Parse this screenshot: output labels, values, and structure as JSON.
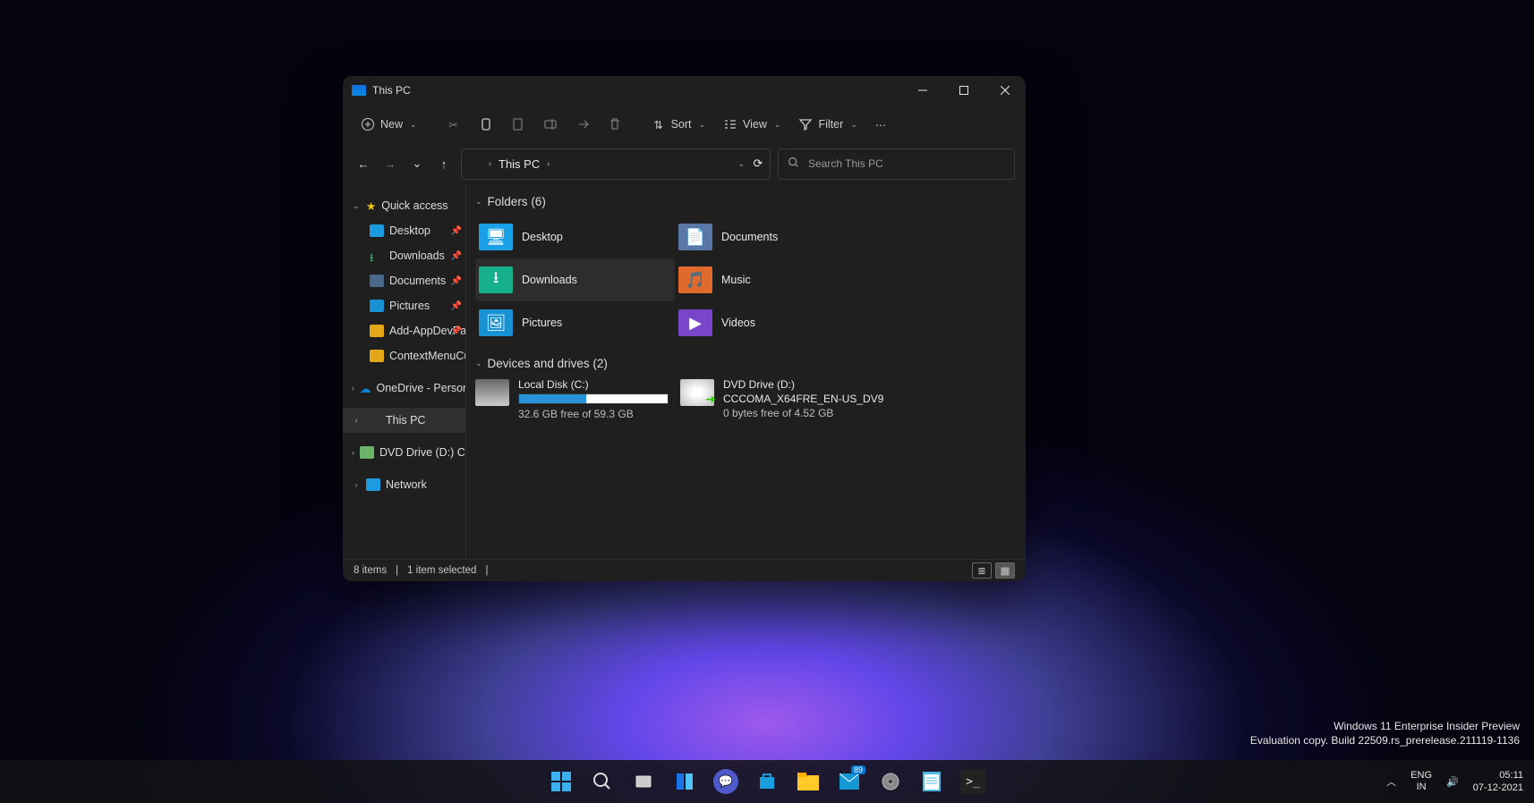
{
  "window": {
    "title": "This PC"
  },
  "toolbar": {
    "new": "New",
    "sort": "Sort",
    "view": "View",
    "filter": "Filter"
  },
  "breadcrumb": {
    "location": "This PC"
  },
  "search": {
    "placeholder": "Search This PC"
  },
  "sidebar": {
    "quick_access": "Quick access",
    "quick_items": [
      {
        "label": "Desktop",
        "pinned": true
      },
      {
        "label": "Downloads",
        "pinned": true
      },
      {
        "label": "Documents",
        "pinned": true
      },
      {
        "label": "Pictures",
        "pinned": true
      },
      {
        "label": "Add-AppDevPa",
        "pinned": true
      },
      {
        "label": "ContextMenuCust",
        "pinned": false
      }
    ],
    "onedrive": "OneDrive - Personal",
    "this_pc": "This PC",
    "dvd": "DVD Drive (D:) CCCO",
    "network": "Network"
  },
  "content": {
    "folders_header": "Folders (6)",
    "folders": [
      {
        "label": "Desktop",
        "color": "#1aa0e6"
      },
      {
        "label": "Documents",
        "color": "#5a78a6"
      },
      {
        "label": "Downloads",
        "color": "#17b08d",
        "selected": true
      },
      {
        "label": "Music",
        "color": "#e06a2b"
      },
      {
        "label": "Pictures",
        "color": "#1892d2"
      },
      {
        "label": "Videos",
        "color": "#7946c9"
      }
    ],
    "drives_header": "Devices and drives (2)",
    "local_disk": {
      "name": "Local Disk (C:)",
      "size": "32.6 GB free of 59.3 GB",
      "percent": 45
    },
    "dvd_drive": {
      "name": "DVD Drive (D:)",
      "volume": "CCCOMA_X64FRE_EN-US_DV9",
      "size": "0 bytes free of 4.52 GB"
    }
  },
  "status": {
    "items": "8 items",
    "sel": "1 item selected"
  },
  "watermark": {
    "line1": "Windows 11 Enterprise Insider Preview",
    "line2": "Evaluation copy. Build 22509.rs_prerelease.211119-1136"
  },
  "systray": {
    "lang1": "ENG",
    "lang2": "IN",
    "time": "05:11",
    "date": "07-12-2021",
    "mail_badge": "89"
  }
}
